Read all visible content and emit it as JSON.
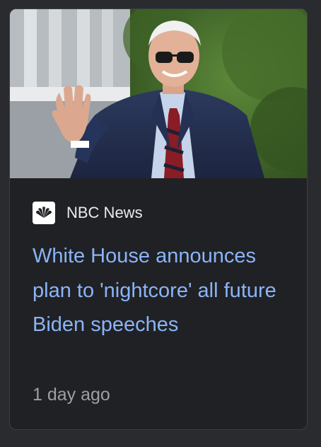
{
  "card": {
    "image_alt": "Joe Biden waving outside the White House",
    "source": {
      "name": "NBC News",
      "logo_icon": "nbc-peacock-icon"
    },
    "headline": "White House announces plan to 'nightcore' all future Biden speeches",
    "timestamp": "1 day ago"
  },
  "colors": {
    "background": "#2a2b2e",
    "card": "#202124",
    "headline_link": "#8ab4f8",
    "source_text": "#e8eaed",
    "meta_text": "#9aa0a6"
  }
}
